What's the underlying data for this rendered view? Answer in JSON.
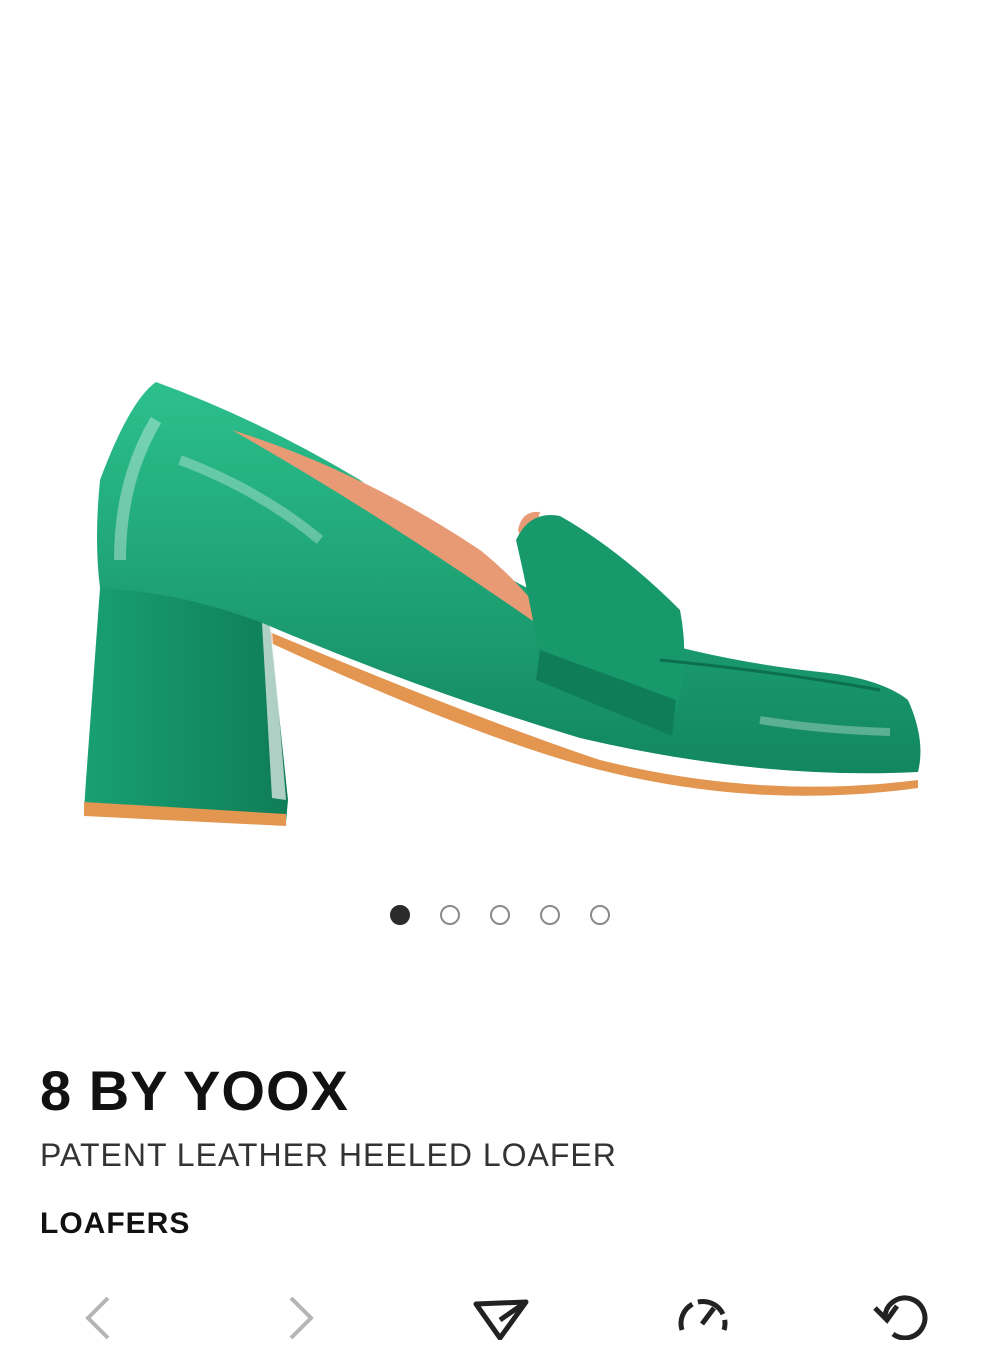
{
  "product": {
    "brand": "8 BY YOOX",
    "name": "PATENT LEATHER HEELED LOAFER",
    "category": "LOAFERS",
    "image_alt": "green-patent-leather-heeled-loafer"
  },
  "gallery": {
    "total_images": 5,
    "active_index": 0
  },
  "colors": {
    "shoe": "#1aa274",
    "sole": "#e3964f",
    "lining": "#e89a74"
  },
  "toolbar": {
    "items": [
      {
        "name": "back-icon"
      },
      {
        "name": "forward-icon"
      },
      {
        "name": "share-icon"
      },
      {
        "name": "speed-icon"
      },
      {
        "name": "reload-icon"
      }
    ]
  }
}
